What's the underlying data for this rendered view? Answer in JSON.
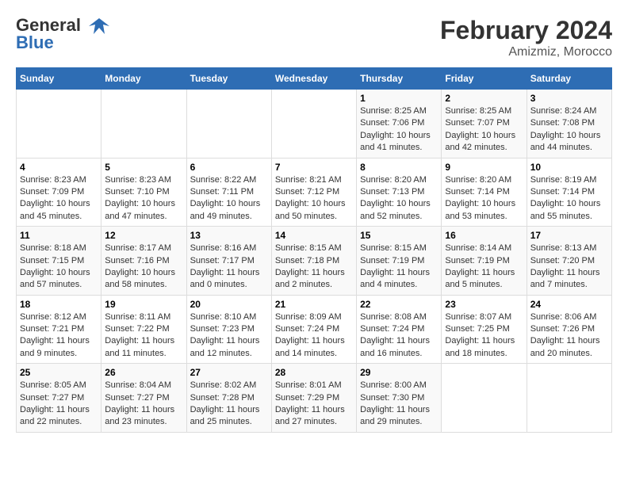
{
  "header": {
    "logo_line1": "General",
    "logo_line2": "Blue",
    "title": "February 2024",
    "subtitle": "Amizmiz, Morocco"
  },
  "days_of_week": [
    "Sunday",
    "Monday",
    "Tuesday",
    "Wednesday",
    "Thursday",
    "Friday",
    "Saturday"
  ],
  "weeks": [
    [
      {
        "num": "",
        "info": ""
      },
      {
        "num": "",
        "info": ""
      },
      {
        "num": "",
        "info": ""
      },
      {
        "num": "",
        "info": ""
      },
      {
        "num": "1",
        "info": "Sunrise: 8:25 AM\nSunset: 7:06 PM\nDaylight: 10 hours\nand 41 minutes."
      },
      {
        "num": "2",
        "info": "Sunrise: 8:25 AM\nSunset: 7:07 PM\nDaylight: 10 hours\nand 42 minutes."
      },
      {
        "num": "3",
        "info": "Sunrise: 8:24 AM\nSunset: 7:08 PM\nDaylight: 10 hours\nand 44 minutes."
      }
    ],
    [
      {
        "num": "4",
        "info": "Sunrise: 8:23 AM\nSunset: 7:09 PM\nDaylight: 10 hours\nand 45 minutes."
      },
      {
        "num": "5",
        "info": "Sunrise: 8:23 AM\nSunset: 7:10 PM\nDaylight: 10 hours\nand 47 minutes."
      },
      {
        "num": "6",
        "info": "Sunrise: 8:22 AM\nSunset: 7:11 PM\nDaylight: 10 hours\nand 49 minutes."
      },
      {
        "num": "7",
        "info": "Sunrise: 8:21 AM\nSunset: 7:12 PM\nDaylight: 10 hours\nand 50 minutes."
      },
      {
        "num": "8",
        "info": "Sunrise: 8:20 AM\nSunset: 7:13 PM\nDaylight: 10 hours\nand 52 minutes."
      },
      {
        "num": "9",
        "info": "Sunrise: 8:20 AM\nSunset: 7:14 PM\nDaylight: 10 hours\nand 53 minutes."
      },
      {
        "num": "10",
        "info": "Sunrise: 8:19 AM\nSunset: 7:14 PM\nDaylight: 10 hours\nand 55 minutes."
      }
    ],
    [
      {
        "num": "11",
        "info": "Sunrise: 8:18 AM\nSunset: 7:15 PM\nDaylight: 10 hours\nand 57 minutes."
      },
      {
        "num": "12",
        "info": "Sunrise: 8:17 AM\nSunset: 7:16 PM\nDaylight: 10 hours\nand 58 minutes."
      },
      {
        "num": "13",
        "info": "Sunrise: 8:16 AM\nSunset: 7:17 PM\nDaylight: 11 hours\nand 0 minutes."
      },
      {
        "num": "14",
        "info": "Sunrise: 8:15 AM\nSunset: 7:18 PM\nDaylight: 11 hours\nand 2 minutes."
      },
      {
        "num": "15",
        "info": "Sunrise: 8:15 AM\nSunset: 7:19 PM\nDaylight: 11 hours\nand 4 minutes."
      },
      {
        "num": "16",
        "info": "Sunrise: 8:14 AM\nSunset: 7:19 PM\nDaylight: 11 hours\nand 5 minutes."
      },
      {
        "num": "17",
        "info": "Sunrise: 8:13 AM\nSunset: 7:20 PM\nDaylight: 11 hours\nand 7 minutes."
      }
    ],
    [
      {
        "num": "18",
        "info": "Sunrise: 8:12 AM\nSunset: 7:21 PM\nDaylight: 11 hours\nand 9 minutes."
      },
      {
        "num": "19",
        "info": "Sunrise: 8:11 AM\nSunset: 7:22 PM\nDaylight: 11 hours\nand 11 minutes."
      },
      {
        "num": "20",
        "info": "Sunrise: 8:10 AM\nSunset: 7:23 PM\nDaylight: 11 hours\nand 12 minutes."
      },
      {
        "num": "21",
        "info": "Sunrise: 8:09 AM\nSunset: 7:24 PM\nDaylight: 11 hours\nand 14 minutes."
      },
      {
        "num": "22",
        "info": "Sunrise: 8:08 AM\nSunset: 7:24 PM\nDaylight: 11 hours\nand 16 minutes."
      },
      {
        "num": "23",
        "info": "Sunrise: 8:07 AM\nSunset: 7:25 PM\nDaylight: 11 hours\nand 18 minutes."
      },
      {
        "num": "24",
        "info": "Sunrise: 8:06 AM\nSunset: 7:26 PM\nDaylight: 11 hours\nand 20 minutes."
      }
    ],
    [
      {
        "num": "25",
        "info": "Sunrise: 8:05 AM\nSunset: 7:27 PM\nDaylight: 11 hours\nand 22 minutes."
      },
      {
        "num": "26",
        "info": "Sunrise: 8:04 AM\nSunset: 7:27 PM\nDaylight: 11 hours\nand 23 minutes."
      },
      {
        "num": "27",
        "info": "Sunrise: 8:02 AM\nSunset: 7:28 PM\nDaylight: 11 hours\nand 25 minutes."
      },
      {
        "num": "28",
        "info": "Sunrise: 8:01 AM\nSunset: 7:29 PM\nDaylight: 11 hours\nand 27 minutes."
      },
      {
        "num": "29",
        "info": "Sunrise: 8:00 AM\nSunset: 7:30 PM\nDaylight: 11 hours\nand 29 minutes."
      },
      {
        "num": "",
        "info": ""
      },
      {
        "num": "",
        "info": ""
      }
    ]
  ]
}
